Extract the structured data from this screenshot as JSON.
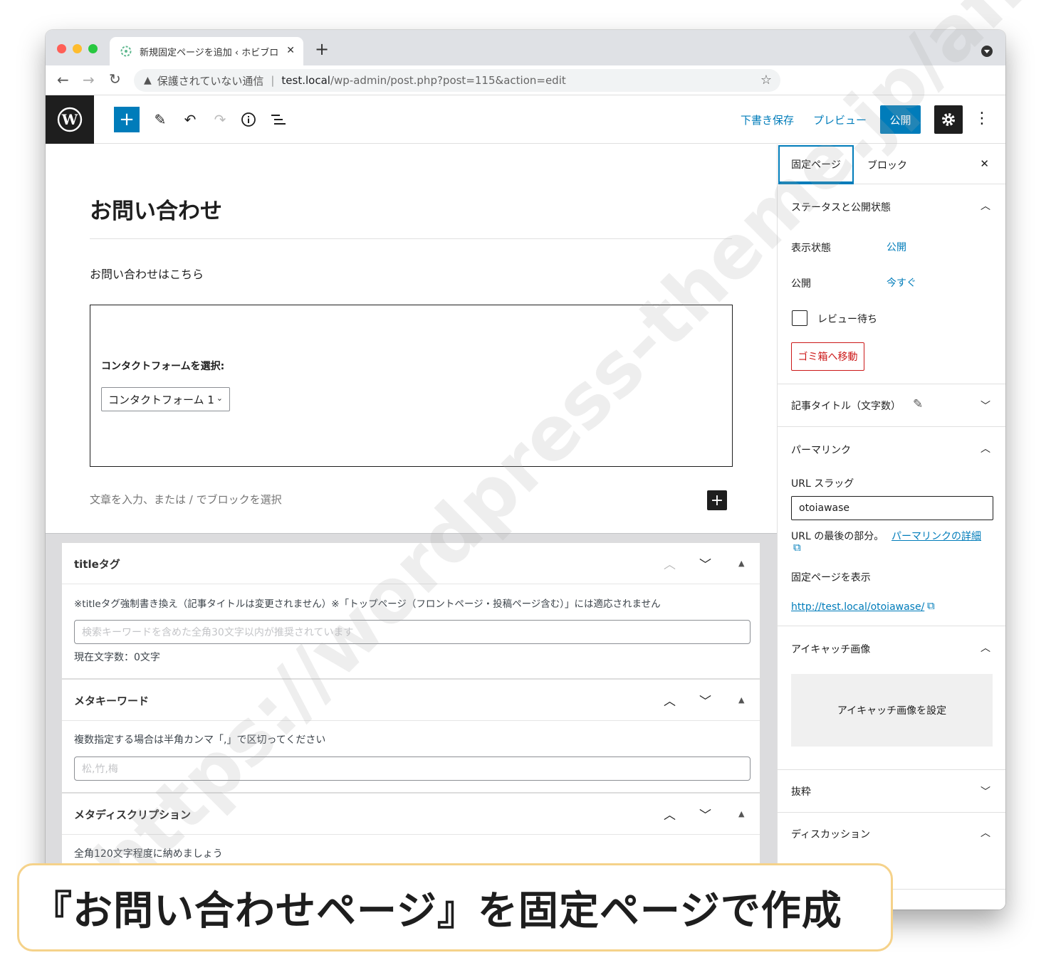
{
  "browser": {
    "tab_title": "新規固定ページを追加 ‹ ホビブロ",
    "url_warning": "保護されていない通信",
    "url_separator": "|",
    "url_host": "test.local",
    "url_path": "/wp-admin/post.php?post=115&action=edit",
    "new_tab_glyph": "+",
    "close_tab_glyph": "✕"
  },
  "toolbar": {
    "save_draft": "下書き保存",
    "preview": "プレビュー",
    "publish": "公開"
  },
  "editor": {
    "post_title": "お問い合わせ",
    "paragraph": "お問い合わせはこちら",
    "contact_block": {
      "label": "コンタクトフォームを選択:",
      "selected": "コンタクトフォーム 1"
    },
    "placeholder": "文章を入力、または / でブロックを選択"
  },
  "meta_boxes": {
    "title_tag": {
      "heading": "titleタグ",
      "note": "※titleタグ強制書き換え（記事タイトルは変更されません）※「トップページ（フロントページ・投稿ページ含む）」には適応されません",
      "placeholder": "検索キーワードを含めた全角30文字以内が推奨されています",
      "count": "現在文字数：0文字"
    },
    "meta_keyword": {
      "heading": "メタキーワード",
      "note": "複数指定する場合は半角カンマ「,」で区切ってください",
      "placeholder": "松,竹,梅"
    },
    "meta_description": {
      "heading": "メタディスクリプション",
      "note": "全角120文字程度に納めましょう"
    }
  },
  "sidebar": {
    "tabs": [
      "固定ページ",
      "ブロック"
    ],
    "close_glyph": "✕",
    "status": {
      "heading": "ステータスと公開状態",
      "visibility_label": "表示状態",
      "visibility_value": "公開",
      "publish_label": "公開",
      "publish_value": "今すぐ",
      "pending_review": "レビュー待ち",
      "trash": "ゴミ箱へ移動"
    },
    "title_count": {
      "heading": "記事タイトル（文字数）"
    },
    "permalink": {
      "heading": "パーマリンク",
      "slug_label": "URL スラッグ",
      "slug_value": "otoiawase",
      "hint_prefix": "URL の最後の部分。",
      "hint_link": "パーマリンクの詳細",
      "view_label": "固定ページを表示",
      "view_url": "http://test.local/otoiawase/"
    },
    "featured_image": {
      "heading": "アイキャッチ画像",
      "button": "アイキャッチ画像を設定"
    },
    "excerpt": {
      "heading": "抜粋"
    },
    "discussion": {
      "heading": "ディスカッション"
    }
  },
  "caption": "『お問い合わせページ』を固定ページで作成",
  "watermark": "https://wordpress-theme.jp/affinger/",
  "colors": {
    "accent": "#007cba",
    "danger": "#cc1818",
    "caption_border": "#f5d28a"
  }
}
